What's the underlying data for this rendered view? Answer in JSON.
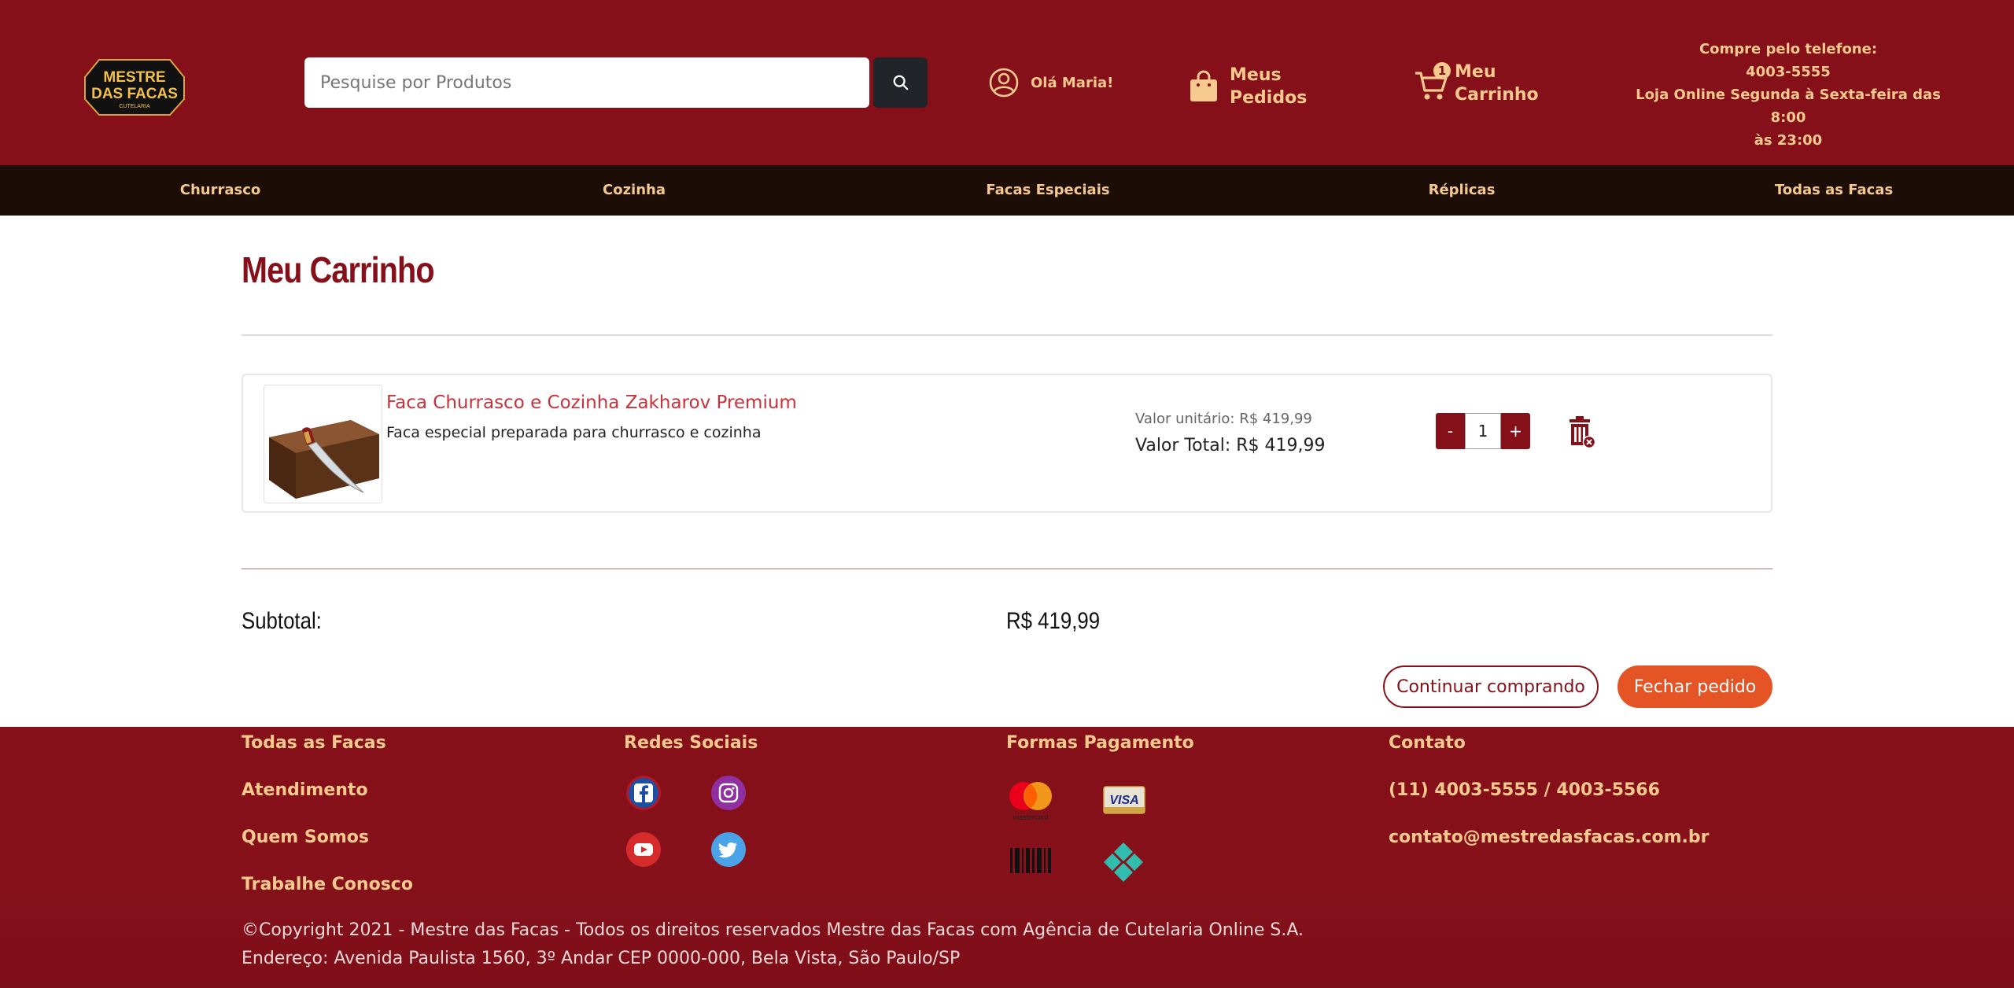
{
  "header": {
    "logo_line1": "MESTRE",
    "logo_line2": "DAS FACAS",
    "logo_line3": "CUTELARIA",
    "search_placeholder": "Pesquise por Produtos",
    "user_label": "Olá Maria!",
    "orders_label": "Meus Pedidos",
    "cart_label": "Meu Carrinho",
    "cart_count": "1",
    "phone_title": "Compre pelo telefone:",
    "phone_number": "4003-5555",
    "hours_line1": "Loja Online Segunda à Sexta-feira das 8:00",
    "hours_line2": "às 23:00"
  },
  "nav": {
    "items": [
      "Churrasco",
      "Cozinha",
      "Facas Especiais",
      "Réplicas",
      "Todas as Facas"
    ]
  },
  "cart": {
    "title": "Meu Carrinho",
    "item": {
      "name": "Faca Churrasco e Cozinha Zakharov Premium",
      "description": "Faca especial preparada para churrasco e cozinha",
      "unit_price": "Valor unitário: R$ 419,99",
      "total_price": "Valor Total: R$ 419,99",
      "quantity": "1",
      "minus_label": "-",
      "plus_label": "+"
    },
    "subtotal_label": "Subtotal:",
    "subtotal_value": "R$ 419,99",
    "continue_label": "Continuar comprando",
    "checkout_label": "Fechar pedido"
  },
  "footer": {
    "links": [
      "Todas as Facas",
      "Atendimento",
      "Quem Somos",
      "Trabalhe Conosco"
    ],
    "social_title": "Redes Sociais",
    "payment_title": "Formas Pagamento",
    "mastercard_label": "mastercard",
    "visa_label": "VISA",
    "contact_title": "Contato",
    "contact_phone": "(11) 4003-5555 / 4003-5566",
    "contact_email": "contato@mestredasfacas.com.br",
    "copyright_line1": "©Copyright 2021 - Mestre das Facas - Todos os direitos reservados Mestre das Facas com Agência de Cutelaria Online S.A.",
    "copyright_line2": "Endereço: Avenida Paulista 1560, 3º Andar CEP 0000-000, Bela Vista, São Paulo/SP"
  },
  "colors": {
    "brand_red": "#861019",
    "gold": "#f6c98e",
    "nav_dark": "#1c0d06",
    "checkout_orange": "#e55424"
  },
  "icons": {
    "search": "search-icon",
    "user": "user-circle-icon",
    "orders": "shopping-bag-icon",
    "cart": "cart-icon",
    "trash": "trash-icon",
    "facebook": "facebook-icon",
    "instagram": "instagram-icon",
    "youtube": "youtube-icon",
    "twitter": "twitter-icon",
    "mastercard": "mastercard-icon",
    "visa": "visa-icon",
    "boleto": "barcode-icon",
    "pix": "pix-icon"
  }
}
